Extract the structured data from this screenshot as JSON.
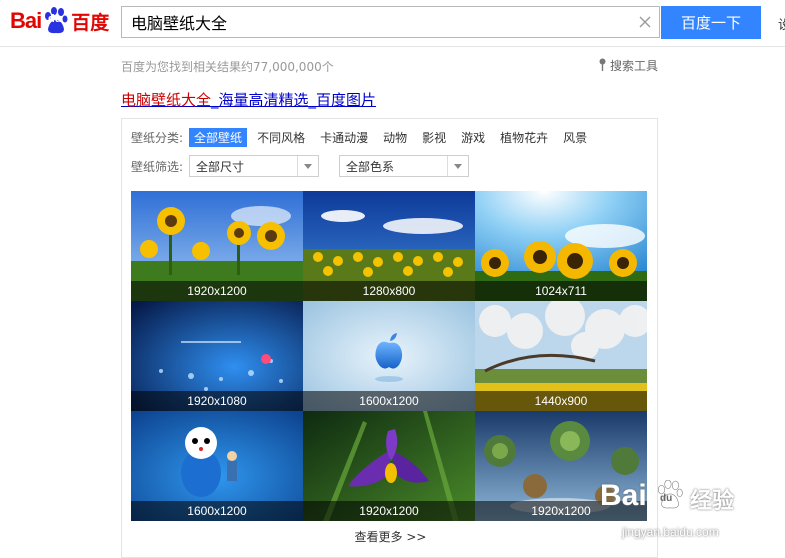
{
  "header": {
    "logo": {
      "bai": "Bai",
      "du": "du",
      "cn": "百度"
    },
    "search_value": "电脑壁纸大全",
    "search_button": "百度一下",
    "edge_text": "设"
  },
  "meta": {
    "result_count": "百度为您找到相关结果约77,000,000个",
    "tools": "搜索工具"
  },
  "result": {
    "title_highlight": "电脑壁纸大全",
    "title_rest": "_海量高清精选_百度图片"
  },
  "filters": {
    "category_label": "壁纸分类:",
    "categories": [
      "全部壁纸",
      "不同风格",
      "卡通动漫",
      "动物",
      "影视",
      "游戏",
      "植物花卉",
      "风景"
    ],
    "filter_label": "壁纸筛选:",
    "size_select": "全部尺寸",
    "color_select": "全部色系"
  },
  "images": [
    {
      "size": "1920x1200",
      "icon": "sunflower-sky"
    },
    {
      "size": "1280x800",
      "icon": "sunflower-field"
    },
    {
      "size": "1024x711",
      "icon": "sunflower-sun"
    },
    {
      "size": "1920x1080",
      "icon": "blue-bokeh"
    },
    {
      "size": "1600x1200",
      "icon": "apple-logo"
    },
    {
      "size": "1440x900",
      "icon": "cherry-blossom"
    },
    {
      "size": "1600x1200",
      "icon": "cartoon-doraemon"
    },
    {
      "size": "1920x1200",
      "icon": "purple-iris"
    },
    {
      "size": "1920x1200",
      "icon": "floating-islands"
    }
  ],
  "more_link": "查看更多 >>",
  "watermark": {
    "brand": "Bai",
    "brand2": "du",
    "cn": "经验",
    "url": "jingyan.baidu.com"
  },
  "colors": {
    "accent": "#3385ff",
    "brand_red": "#e10602",
    "brand_blue": "#2932e1",
    "link": "#0000cc",
    "highlight": "#cc0000"
  }
}
